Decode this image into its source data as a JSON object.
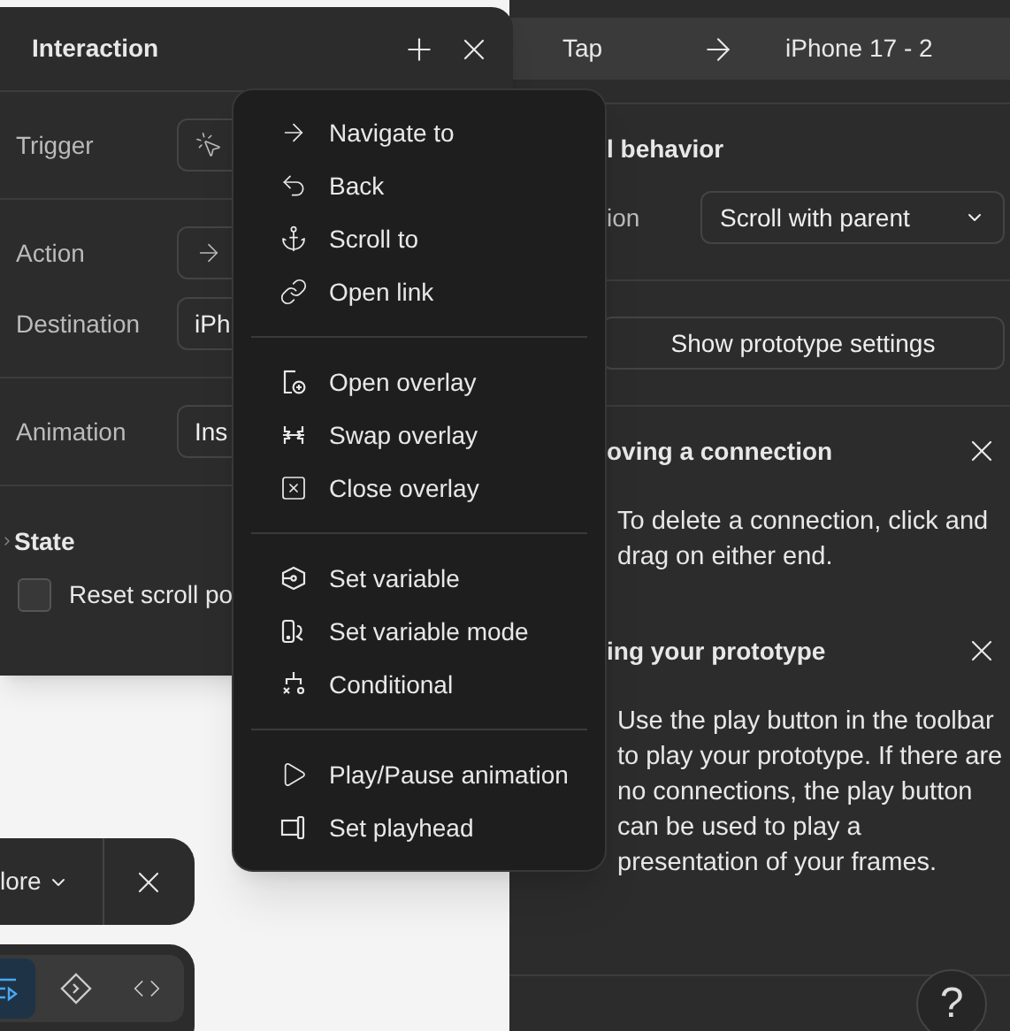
{
  "interaction_panel": {
    "title": "Interaction",
    "rows": [
      {
        "label": "Trigger",
        "value": ""
      },
      {
        "label": "Action",
        "value": ""
      },
      {
        "label": "Destination",
        "value": "iPh"
      },
      {
        "label": "Animation",
        "value": "Ins"
      }
    ],
    "state_section": {
      "title": "State",
      "checkbox": {
        "label": "Reset scroll po",
        "checked": false
      }
    }
  },
  "action_menu": {
    "groups": [
      [
        {
          "label": "Navigate to"
        },
        {
          "label": "Back"
        },
        {
          "label": "Scroll to"
        },
        {
          "label": "Open link"
        }
      ],
      [
        {
          "label": "Open overlay"
        },
        {
          "label": "Swap overlay"
        },
        {
          "label": "Close overlay"
        }
      ],
      [
        {
          "label": "Set variable"
        },
        {
          "label": "Set variable mode"
        },
        {
          "label": "Conditional"
        }
      ],
      [
        {
          "label": "Play/Pause animation"
        },
        {
          "label": "Set playhead"
        }
      ]
    ]
  },
  "right_panel": {
    "connection": {
      "trigger": "Tap",
      "target": "iPhone 17 - 2"
    },
    "scroll_section": {
      "title": "l behavior",
      "field_label": "ion",
      "select_value": "Scroll with parent"
    },
    "settings_button": "Show prototype settings",
    "tips": [
      {
        "title": "oving a connection",
        "body": "To delete a connection, click and drag on either end."
      },
      {
        "title": "ing your prototype",
        "body": "Use the play button in the toolbar to play your prototype. If there are no connections, the play button can be used to play a presentation of your frames."
      }
    ],
    "help_button": "?"
  },
  "bottom_bar": {
    "more_label": "lore"
  },
  "tool_bar": {
    "tools": [
      {
        "selected": true
      },
      {
        "selected": false
      },
      {
        "selected": false
      }
    ]
  }
}
